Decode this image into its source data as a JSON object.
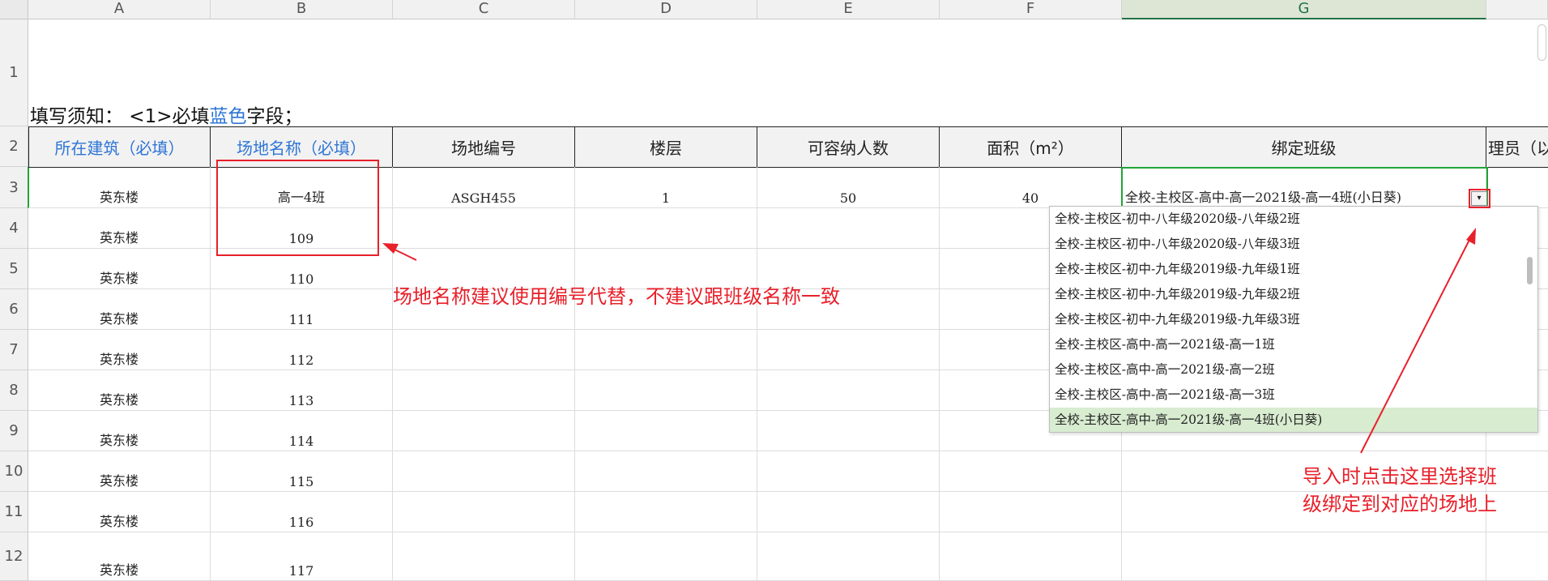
{
  "columns": [
    "A",
    "B",
    "C",
    "D",
    "E",
    "F",
    "G"
  ],
  "row_numbers": [
    "1",
    "2",
    "3",
    "4",
    "5",
    "6",
    "7",
    "8",
    "9",
    "10",
    "11",
    "12"
  ],
  "notice": {
    "prefix": "填写须知：  <1>必填",
    "blue_word": "蓝色",
    "suffix": "字段；"
  },
  "headers": [
    "所在建筑（必填）",
    "场地名称（必填）",
    "场地编号",
    "楼层",
    "可容纳人数",
    "面积（m²）",
    "绑定班级",
    "理员（以"
  ],
  "rows": [
    [
      "英东楼",
      "高一4班",
      "ASGH455",
      "1",
      "50",
      "40",
      "全校-主校区-高中-高一2021级-高一4班(小日葵)"
    ],
    [
      "英东楼",
      "109",
      "",
      "",
      "",
      "",
      ""
    ],
    [
      "英东楼",
      "110",
      "",
      "",
      "",
      "",
      ""
    ],
    [
      "英东楼",
      "111",
      "",
      "",
      "",
      "",
      ""
    ],
    [
      "英东楼",
      "112",
      "",
      "",
      "",
      "",
      ""
    ],
    [
      "英东楼",
      "113",
      "",
      "",
      "",
      "",
      ""
    ],
    [
      "英东楼",
      "114",
      "",
      "",
      "",
      "",
      ""
    ],
    [
      "英东楼",
      "115",
      "",
      "",
      "",
      "",
      ""
    ],
    [
      "英东楼",
      "116",
      "",
      "",
      "",
      "",
      ""
    ],
    [
      "英东楼",
      "117",
      "",
      "",
      "",
      "",
      ""
    ]
  ],
  "dropdown": {
    "options": [
      "全校-主校区-初中-八年级2020级-八年级2班",
      "全校-主校区-初中-八年级2020级-八年级3班",
      "全校-主校区-初中-九年级2019级-九年级1班",
      "全校-主校区-初中-九年级2019级-九年级2班",
      "全校-主校区-初中-九年级2019级-九年级3班",
      "全校-主校区-高中-高一2021级-高一1班",
      "全校-主校区-高中-高一2021级-高一2班",
      "全校-主校区-高中-高一2021级-高一3班",
      "全校-主校区-高中-高一2021级-高一4班(小日葵)"
    ],
    "selected_index": 8,
    "button_glyph": "▾"
  },
  "annotations": {
    "venue_name_tip": "场地名称建议使用编号代替，不建议跟班级名称一致",
    "bind_tip_line1": "导入时点击这里选择班",
    "bind_tip_line2": "级绑定到对应的场地上"
  },
  "colors": {
    "header_blue": "#2e75d6",
    "annotation_red": "#e8202a",
    "active_green": "#21a336"
  }
}
